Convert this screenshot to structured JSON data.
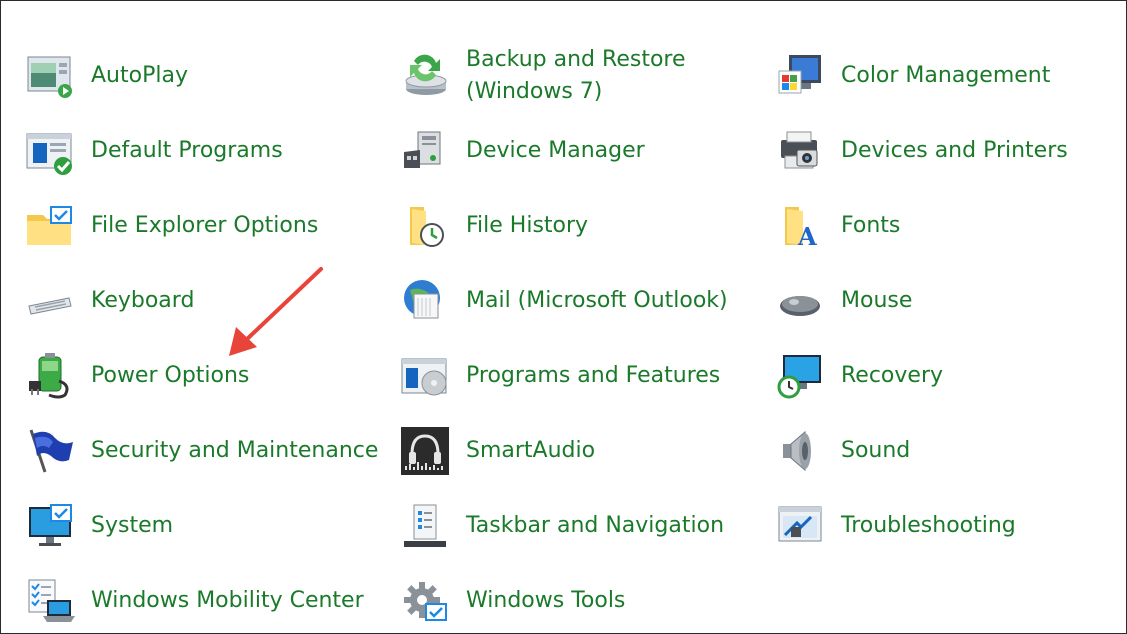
{
  "items": [
    {
      "label": "AutoPlay",
      "icon": "autoplay-icon"
    },
    {
      "label": "Backup and Restore (Windows 7)",
      "icon": "backup-restore-icon"
    },
    {
      "label": "Color Management",
      "icon": "color-management-icon"
    },
    {
      "label": "Default Programs",
      "icon": "default-programs-icon"
    },
    {
      "label": "Device Manager",
      "icon": "device-manager-icon"
    },
    {
      "label": "Devices and Printers",
      "icon": "devices-printers-icon"
    },
    {
      "label": "File Explorer Options",
      "icon": "file-explorer-options-icon"
    },
    {
      "label": "File History",
      "icon": "file-history-icon"
    },
    {
      "label": "Fonts",
      "icon": "fonts-icon"
    },
    {
      "label": "Keyboard",
      "icon": "keyboard-icon"
    },
    {
      "label": "Mail (Microsoft Outlook)",
      "icon": "mail-icon"
    },
    {
      "label": "Mouse",
      "icon": "mouse-icon"
    },
    {
      "label": "Power Options",
      "icon": "power-options-icon"
    },
    {
      "label": "Programs and Features",
      "icon": "programs-features-icon"
    },
    {
      "label": "Recovery",
      "icon": "recovery-icon"
    },
    {
      "label": "Security and Maintenance",
      "icon": "security-flag-icon"
    },
    {
      "label": "SmartAudio",
      "icon": "smartaudio-icon"
    },
    {
      "label": "Sound",
      "icon": "sound-speaker-icon"
    },
    {
      "label": "System",
      "icon": "system-monitor-icon"
    },
    {
      "label": "Taskbar and Navigation",
      "icon": "taskbar-navigation-icon"
    },
    {
      "label": "Troubleshooting",
      "icon": "troubleshooting-icon"
    },
    {
      "label": "Windows Mobility Center",
      "icon": "mobility-center-icon"
    },
    {
      "label": "Windows Tools",
      "icon": "windows-tools-icon"
    }
  ],
  "colors": {
    "link": "#1a7a2a",
    "annotation_arrow": "#e8443a",
    "border": "#2b2b2b"
  }
}
